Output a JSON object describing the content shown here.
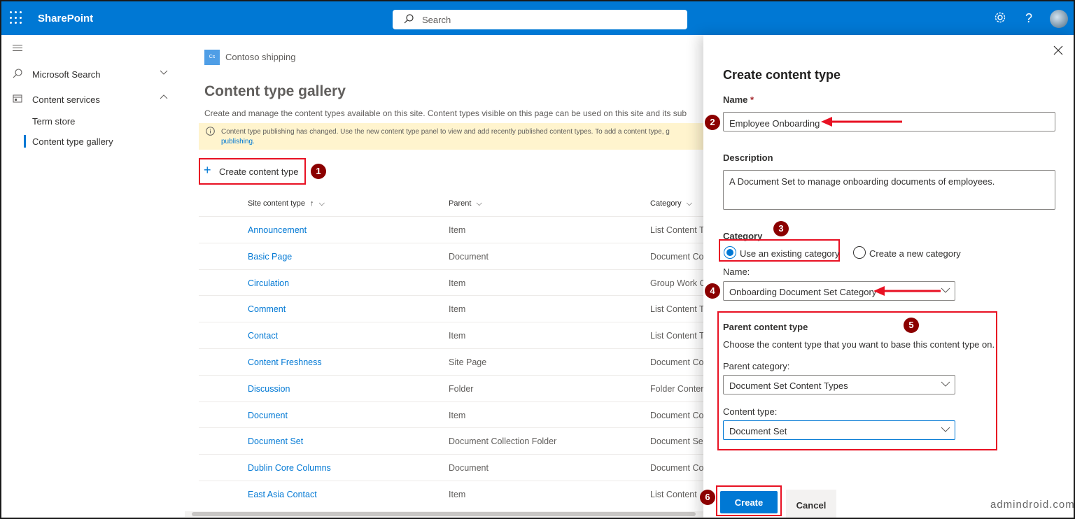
{
  "header": {
    "app_name": "SharePoint",
    "search_placeholder": "Search"
  },
  "nav": {
    "items": [
      {
        "label": "Microsoft Search",
        "icon": "search-icon"
      },
      {
        "label": "Content services",
        "icon": "content-services-icon"
      }
    ],
    "subitems": [
      {
        "label": "Term store"
      },
      {
        "label": "Content type gallery"
      }
    ]
  },
  "main": {
    "site_icon_text": "Cs",
    "site_name": "Contoso shipping",
    "title": "Content type gallery",
    "description": "Create and manage the content types available on this site. Content types visible on this page can be used on this site and its sub",
    "notice_text": "Content type publishing has changed. Use the new content type panel to view and add recently published content types. To add a content type, g",
    "notice_link": "publishing.",
    "create_label": "Create content type",
    "columns": [
      "Site content type",
      "Parent",
      "Category"
    ],
    "rows": [
      {
        "name": "Announcement",
        "parent": "Item",
        "category": "List Content T"
      },
      {
        "name": "Basic Page",
        "parent": "Document",
        "category": "Document Co"
      },
      {
        "name": "Circulation",
        "parent": "Item",
        "category": "Group Work C"
      },
      {
        "name": "Comment",
        "parent": "Item",
        "category": "List Content T"
      },
      {
        "name": "Contact",
        "parent": "Item",
        "category": "List Content T"
      },
      {
        "name": "Content Freshness",
        "parent": "Site Page",
        "category": "Document Co"
      },
      {
        "name": "Discussion",
        "parent": "Folder",
        "category": "Folder Conter"
      },
      {
        "name": "Document",
        "parent": "Item",
        "category": "Document Co"
      },
      {
        "name": "Document Set",
        "parent": "Document Collection Folder",
        "category": "Document Se"
      },
      {
        "name": "Dublin Core Columns",
        "parent": "Document",
        "category": "Document Co"
      },
      {
        "name": "East Asia Contact",
        "parent": "Item",
        "category": "List Content"
      }
    ]
  },
  "panel": {
    "title": "Create content type",
    "name_label": "Name",
    "required_marker": "*",
    "name_value": "Employee Onboarding",
    "description_label": "Description",
    "description_value": "A Document Set to manage onboarding documents of employees.",
    "category_label": "Category",
    "category_option_existing": "Use an existing category",
    "category_option_new": "Create a new category",
    "category_name_label": "Name:",
    "category_name_value": "Onboarding Document Set Category",
    "parent_heading": "Parent content type",
    "parent_desc": "Choose the content type that you want to base this content type on.",
    "parent_category_label": "Parent category:",
    "parent_category_value": "Document Set Content Types",
    "content_type_label": "Content type:",
    "content_type_value": "Document Set",
    "create_button": "Create",
    "cancel_button": "Cancel"
  },
  "annotations": {
    "badges": [
      "1",
      "2",
      "3",
      "4",
      "5",
      "6"
    ],
    "highlight_color": "#e81123",
    "badge_color": "#8b0000"
  },
  "watermark": "admindroid.com",
  "colors": {
    "brand": "#0078d4",
    "notice_bg": "#fff4ce"
  }
}
